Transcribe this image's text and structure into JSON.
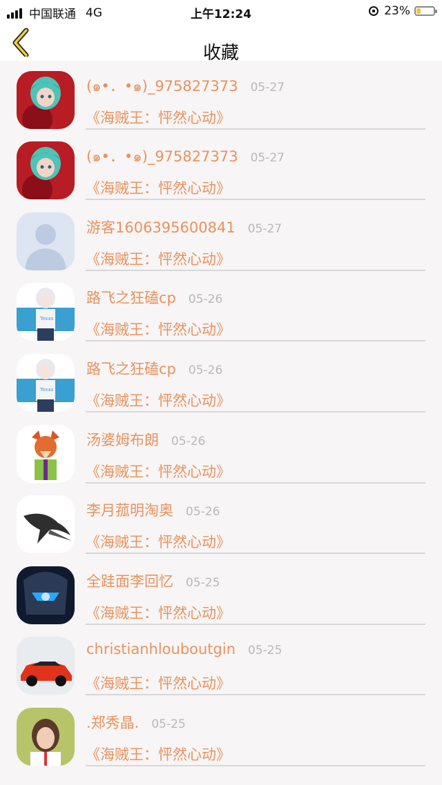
{
  "status_bar": {
    "carrier": "中国联通",
    "network": "4G",
    "time": "上午12:24",
    "battery": "23%",
    "battery_level": 0.23
  },
  "header": {
    "title": "收藏",
    "back_icon": "chevron-left-icon"
  },
  "items": [
    {
      "name": "",
      "date": "",
      "title": "《海贼王：怦然心动》",
      "avatar": "dark"
    },
    {
      "name": "(๑•．•๑)_975827373",
      "date": "05-27",
      "title": "《海贼王：怦然心动》",
      "avatar": "anime-red"
    },
    {
      "name": "(๑•．•๑)_975827373",
      "date": "05-27",
      "title": "《海贼王：怦然心动》",
      "avatar": "anime-red"
    },
    {
      "name": "游客1606395600841",
      "date": "05-27",
      "title": "《海贼王：怦然心动》",
      "avatar": "default-person"
    },
    {
      "name": "路飞之狂磕cp",
      "date": "05-26",
      "title": "《海贼王：怦然心动》",
      "avatar": "anime-blue"
    },
    {
      "name": "路飞之狂磕cp",
      "date": "05-26",
      "title": "《海贼王：怦然心动》",
      "avatar": "anime-blue"
    },
    {
      "name": "汤婆姆布朗",
      "date": "05-26",
      "title": "《海贼王：怦然心动》",
      "avatar": "fox"
    },
    {
      "name": "李月菰明淘奥",
      "date": "05-26",
      "title": "《海贼王：怦然心动》",
      "avatar": "swallow"
    },
    {
      "name": "全跬面李回忆",
      "date": "05-25",
      "title": "《海贼王：怦然心动》",
      "avatar": "helmet"
    },
    {
      "name": "christianhlouboutgin",
      "date": "05-25",
      "title": "《海贼王：怦然心动》",
      "avatar": "car"
    },
    {
      "name": ".郑秀晶.",
      "date": "05-25",
      "title": "《海贼王：怦然心动》",
      "avatar": "portrait"
    }
  ]
}
